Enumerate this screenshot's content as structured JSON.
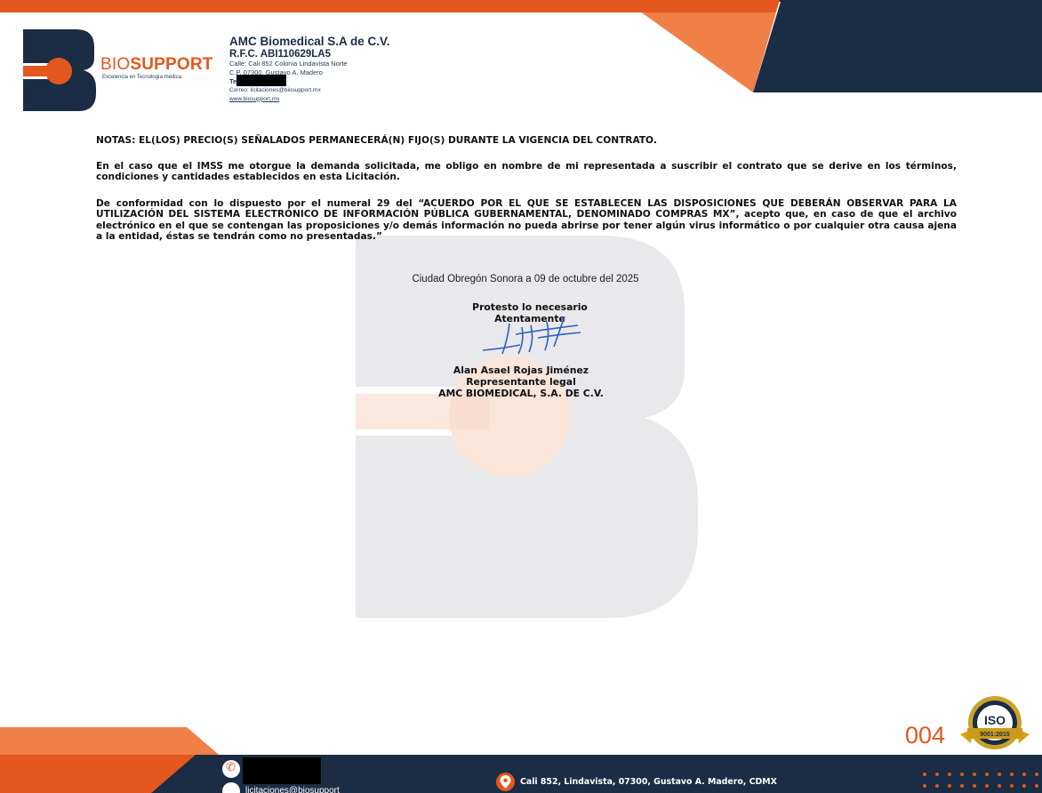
{
  "header": {
    "logo": {
      "brand_prefix": "BIO",
      "brand_suffix": "SUPPORT",
      "tagline": "Excelencia en Tecnología médica"
    },
    "company_name": "AMC Biomedical S.A de C.V.",
    "rfc": "R.F.C. ABI110629LA5",
    "address_line1": "Calle: Cali 852 Colonia Lindavista Norte",
    "address_line2": "C.P. 07300, Gustavo A. Madero",
    "tel_label": "Te",
    "email_line": "Correo: licitaciones@biosupport.mx",
    "website": "www.biosupport.mx"
  },
  "body": {
    "notas": "NOTAS: EL(LOS) PRECIO(S) SEÑALADOS PERMANECERÁ(N) FIJO(S) DURANTE LA VIGENCIA DEL CONTRATO.",
    "paragraph1": "En el caso que el IMSS me otorgue la demanda solicitada, me obligo en nombre de mi representada a suscribir el contrato que se derive en los términos, condiciones y cantidades establecidos en esta Licitación.",
    "paragraph2": "De conformidad con lo dispuesto por el numeral 29 del “ACUERDO POR EL QUE SE ESTABLECEN LAS DISPOSICIONES QUE DEBERÁN OBSERVAR PARA LA UTILIZACIÓN DEL SISTEMA ELECTRÓNICO DE INFORMACIÓN PÚBLICA GUBERNAMENTAL, DENOMINADO COMPRAS MX”, acepto que, en caso de que el archivo electrónico en el que se contengan las proposiciones y/o demás información no pueda abrirse por tener algún virus informático o por cualquier otra causa ajena a la entidad, éstas se tendrán como no presentadas.”"
  },
  "signature_block": {
    "place_date": "Ciudad Obregón Sonora a 09 de octubre del 2025",
    "protesto": "Protesto lo necesario",
    "atentamente": "Atentamente",
    "signer_name": "Alan Asael Rojas Jiménez",
    "signer_role": "Representante legal",
    "signer_company": "AMC BIOMEDICAL, S.A. DE C.V."
  },
  "page_number": "004",
  "iso_badge": {
    "top": "ISO",
    "bottom": "9001:2015"
  },
  "footer": {
    "email_partial": "licitaciones@biosupport",
    "address": "Cali 852, Lindavista, 07300, Gustavo A. Madero, CDMX"
  },
  "colors": {
    "brand_orange": "#e4571e",
    "brand_navy": "#1b2d45",
    "watermark": "#e6e6e8"
  },
  "icons": [
    "phone-icon",
    "mail-icon",
    "location-pin-icon"
  ]
}
